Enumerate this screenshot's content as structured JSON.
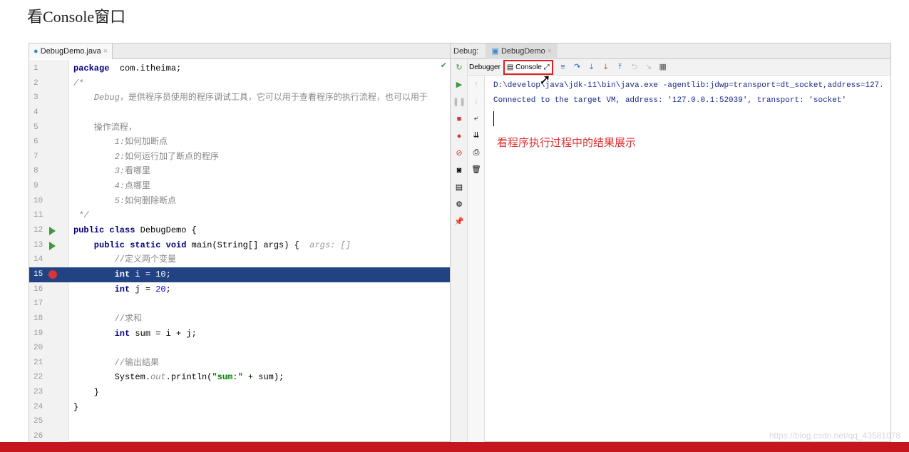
{
  "title": "看Console窗口",
  "editor": {
    "tab": "DebugDemo.java",
    "lines": [
      {
        "n": "1",
        "p": [
          [
            "kw",
            "package"
          ],
          [
            "",
            "  com.itheima;"
          ]
        ]
      },
      {
        "n": "2",
        "p": [
          [
            "cm",
            "/*"
          ]
        ]
      },
      {
        "n": "3",
        "p": [
          [
            "cm",
            "    Debug"
          ],
          [
            "cmc",
            "，是供程序员使用的程序调试工具，它可以用于查看程序的执行流程，也可以用于"
          ]
        ]
      },
      {
        "n": "4",
        "p": []
      },
      {
        "n": "5",
        "p": [
          [
            "cmc",
            "    操作流程，"
          ]
        ]
      },
      {
        "n": "6",
        "p": [
          [
            "cm",
            "        1:"
          ],
          [
            "cmc",
            "如何加断点"
          ]
        ]
      },
      {
        "n": "7",
        "p": [
          [
            "cm",
            "        2:"
          ],
          [
            "cmc",
            "如何运行加了断点的程序"
          ]
        ]
      },
      {
        "n": "8",
        "p": [
          [
            "cm",
            "        3:"
          ],
          [
            "cmc",
            "看哪里"
          ]
        ]
      },
      {
        "n": "9",
        "p": [
          [
            "cm",
            "        4:"
          ],
          [
            "cmc",
            "点哪里"
          ]
        ]
      },
      {
        "n": "10",
        "p": [
          [
            "cm",
            "        5:"
          ],
          [
            "cmc",
            "如何删除断点"
          ]
        ]
      },
      {
        "n": "11",
        "p": [
          [
            "cm",
            " */"
          ]
        ]
      },
      {
        "n": "12",
        "m": "run",
        "p": [
          [
            "kw",
            "public class"
          ],
          [
            "",
            " DebugDemo {"
          ]
        ]
      },
      {
        "n": "13",
        "m": "run",
        "p": [
          [
            "kw",
            "    public static void"
          ],
          [
            "",
            " main(String[] args) {  "
          ],
          [
            "hint",
            "args: []"
          ]
        ]
      },
      {
        "n": "14",
        "p": [
          [
            "cmc",
            "        //定义两个变量"
          ]
        ]
      },
      {
        "n": "15",
        "m": "bp",
        "h": true,
        "p": [
          [
            "kw",
            "        int"
          ],
          [
            "",
            " i = 10;"
          ]
        ]
      },
      {
        "n": "16",
        "p": [
          [
            "kw",
            "        int"
          ],
          [
            "",
            " j = "
          ],
          [
            "num",
            "20"
          ],
          [
            "",
            ";"
          ]
        ]
      },
      {
        "n": "17",
        "p": []
      },
      {
        "n": "18",
        "p": [
          [
            "cmc",
            "        //求和"
          ]
        ]
      },
      {
        "n": "19",
        "p": [
          [
            "kw",
            "        int"
          ],
          [
            "",
            " sum = i + j;"
          ]
        ]
      },
      {
        "n": "20",
        "p": []
      },
      {
        "n": "21",
        "p": [
          [
            "cmc",
            "        //输出结果"
          ]
        ]
      },
      {
        "n": "22",
        "p": [
          [
            "",
            "        System."
          ],
          [
            "cm",
            "out"
          ],
          [
            "",
            ".println("
          ],
          [
            "str",
            "\"sum:\""
          ],
          [
            "",
            " + sum);"
          ]
        ]
      },
      {
        "n": "23",
        "p": [
          [
            "",
            "    }"
          ]
        ]
      },
      {
        "n": "24",
        "p": [
          [
            "",
            "}"
          ]
        ]
      },
      {
        "n": "25",
        "p": []
      },
      {
        "n": "26",
        "p": []
      }
    ]
  },
  "debug": {
    "label": "Debug:",
    "tab": "DebugDemo",
    "debugger_tab": "Debugger",
    "console_tab": "Console",
    "console_lines": [
      "D:\\develop\\java\\jdk-11\\bin\\java.exe -agentlib:jdwp=transport=dt_socket,address=127.0.",
      "Connected to the target VM, address: '127.0.0.1:52039', transport: 'socket'"
    ],
    "annotation": "看程序执行过程中的结果展示"
  },
  "watermark": "https://blog.csdn.net/qq_43581078",
  "colors": {
    "highlight": "#214283",
    "annotation": "#e03030",
    "bottom_bar": "#c4161c"
  }
}
